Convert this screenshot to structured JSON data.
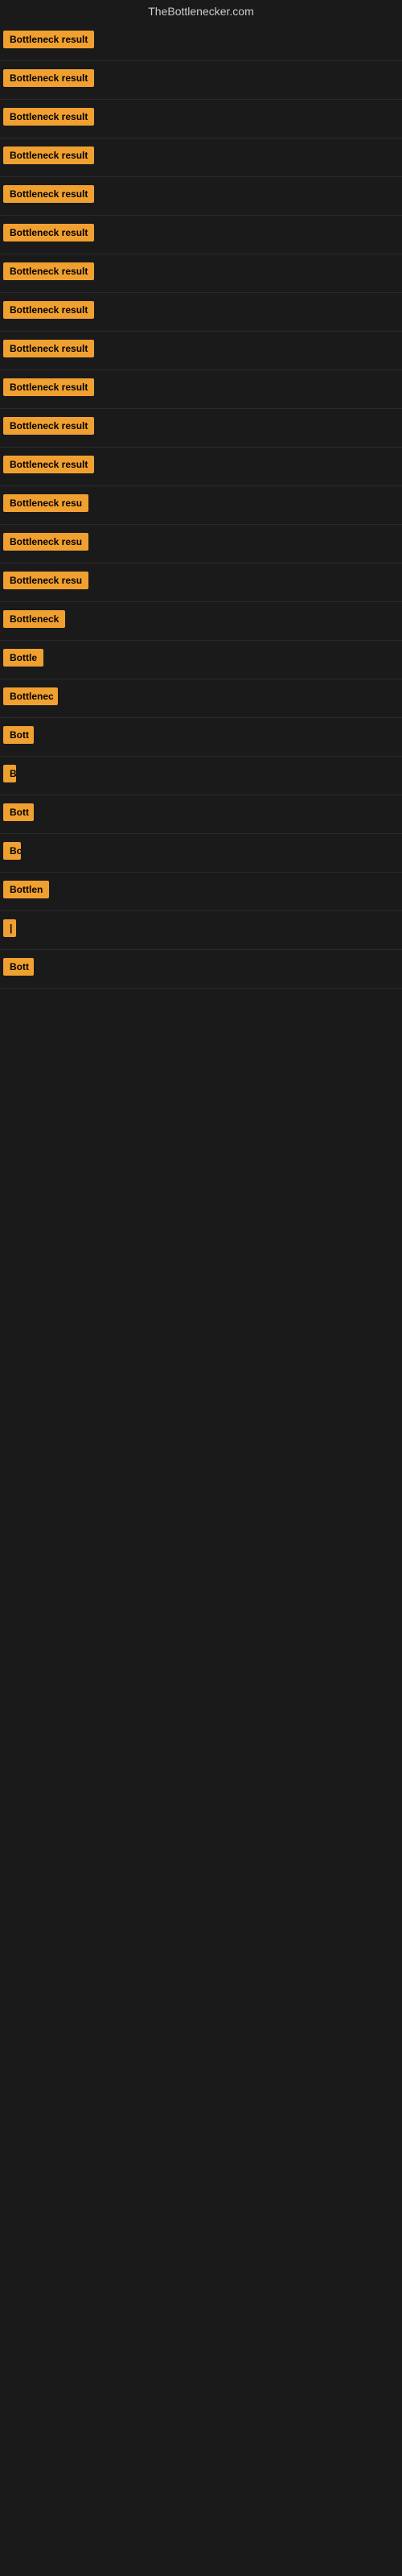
{
  "site": {
    "title": "TheBottlenecker.com"
  },
  "results": [
    {
      "label": "Bottleneck result",
      "width": 120
    },
    {
      "label": "Bottleneck result",
      "width": 120
    },
    {
      "label": "Bottleneck result",
      "width": 120
    },
    {
      "label": "Bottleneck result",
      "width": 120
    },
    {
      "label": "Bottleneck result",
      "width": 120
    },
    {
      "label": "Bottleneck result",
      "width": 120
    },
    {
      "label": "Bottleneck result",
      "width": 120
    },
    {
      "label": "Bottleneck result",
      "width": 120
    },
    {
      "label": "Bottleneck result",
      "width": 120
    },
    {
      "label": "Bottleneck result",
      "width": 120
    },
    {
      "label": "Bottleneck result",
      "width": 120
    },
    {
      "label": "Bottleneck result",
      "width": 120
    },
    {
      "label": "Bottleneck resu",
      "width": 108
    },
    {
      "label": "Bottleneck resu",
      "width": 108
    },
    {
      "label": "Bottleneck resu",
      "width": 108
    },
    {
      "label": "Bottleneck",
      "width": 80
    },
    {
      "label": "Bottle",
      "width": 55
    },
    {
      "label": "Bottlenec",
      "width": 68
    },
    {
      "label": "Bott",
      "width": 38
    },
    {
      "label": "B",
      "width": 14
    },
    {
      "label": "Bott",
      "width": 38
    },
    {
      "label": "Bo",
      "width": 22
    },
    {
      "label": "Bottlen",
      "width": 58
    },
    {
      "label": "|",
      "width": 8
    },
    {
      "label": "Bott",
      "width": 38
    }
  ]
}
